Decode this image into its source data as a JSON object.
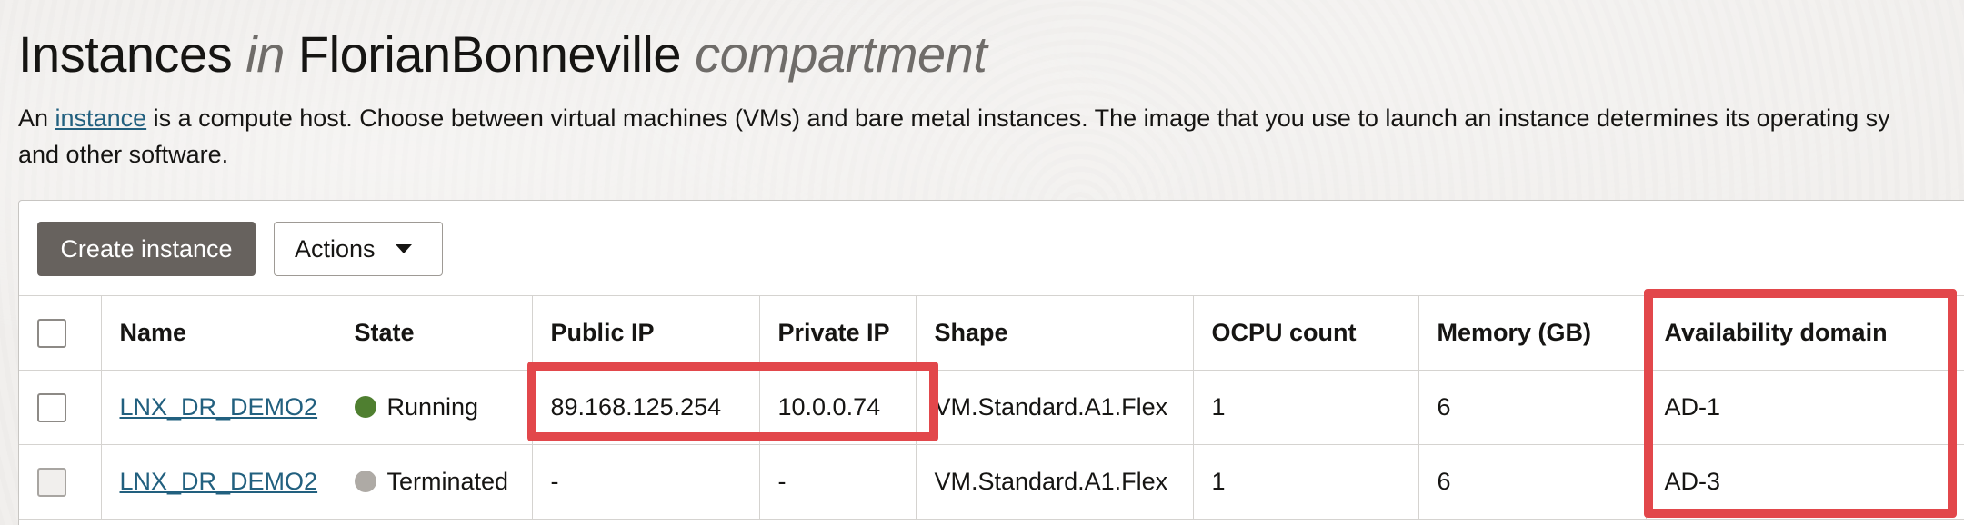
{
  "header": {
    "title_prefix": "Instances",
    "title_in": "in",
    "compartment_name": "FlorianBonneville",
    "title_suffix": "compartment"
  },
  "description": {
    "lead": "An",
    "link_text": "instance",
    "line1_rest": "is a compute host. Choose between virtual machines (VMs) and bare metal instances. The image that you use to launch an instance determines its operating sy",
    "line2": "and other software."
  },
  "toolbar": {
    "create_label": "Create instance",
    "actions_label": "Actions"
  },
  "table": {
    "columns": [
      "Name",
      "State",
      "Public IP",
      "Private IP",
      "Shape",
      "OCPU count",
      "Memory (GB)",
      "Availability domain"
    ],
    "rows": [
      {
        "name": "LNX_DR_DEMO2",
        "state": "Running",
        "public_ip": "89.168.125.254",
        "private_ip": "10.0.0.74",
        "shape": "VM.Standard.A1.Flex",
        "ocpu": "1",
        "memory": "6",
        "ad": "AD-1"
      },
      {
        "name": "LNX_DR_DEMO2",
        "state": "Terminated",
        "public_ip": "-",
        "private_ip": "-",
        "shape": "VM.Standard.A1.Flex",
        "ocpu": "1",
        "memory": "6",
        "ad": "AD-3"
      }
    ]
  },
  "colors": {
    "running": "#4f7f30",
    "terminated": "#aeaaa5",
    "highlight": "#e2474b",
    "link": "#22607f",
    "primary_button": "#67625e"
  }
}
